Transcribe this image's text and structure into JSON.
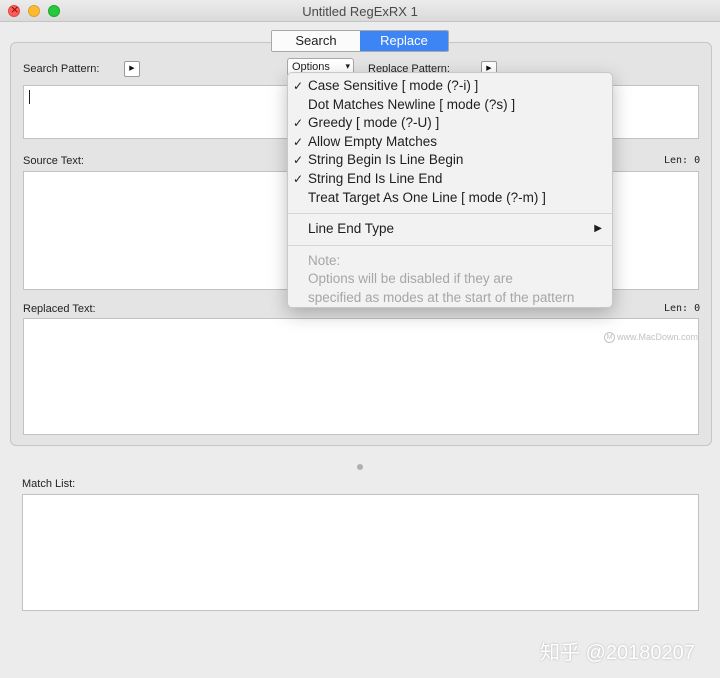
{
  "window": {
    "title": "Untitled RegExRX 1"
  },
  "tabs": [
    {
      "label": "Search",
      "active": false
    },
    {
      "label": "Replace",
      "active": true
    }
  ],
  "search_pattern": {
    "label": "Search Pattern:",
    "value": ""
  },
  "options_button": {
    "label": "Options",
    "chevron": "chevron-down-icon"
  },
  "replace_pattern": {
    "label": "Replace Pattern:"
  },
  "source_text": {
    "label": "Source Text:",
    "len_label": "Len:",
    "len_value": "0"
  },
  "replaced_text": {
    "label": "Replaced Text:",
    "len_label": "Len:",
    "len_value": "0"
  },
  "match_list": {
    "label": "Match List:"
  },
  "options_menu": {
    "items": [
      {
        "label": "Case Sensitive [ mode (?-i) ]",
        "checked": true
      },
      {
        "label": "Dot Matches Newline [ mode (?s) ]",
        "checked": false
      },
      {
        "label": "Greedy [ mode (?-U) ]",
        "checked": true
      },
      {
        "label": "Allow Empty Matches",
        "checked": true
      },
      {
        "label": "String Begin Is Line Begin",
        "checked": true
      },
      {
        "label": "String End Is Line End",
        "checked": true
      },
      {
        "label": "Treat Target As One Line [ mode (?-m) ]",
        "checked": false
      }
    ],
    "submenu": {
      "label": "Line End Type"
    },
    "note": {
      "title": "Note:",
      "line1": "Options will be disabled if they are",
      "line2": "specified as modes at the start of the pattern"
    }
  },
  "watermark": "www.MacDown.com",
  "credit": "知乎 @20180207",
  "colors": {
    "accent": "#3d85f5",
    "close": "#fc5f57",
    "minimize": "#fdbc2e",
    "maximize": "#28c840"
  }
}
